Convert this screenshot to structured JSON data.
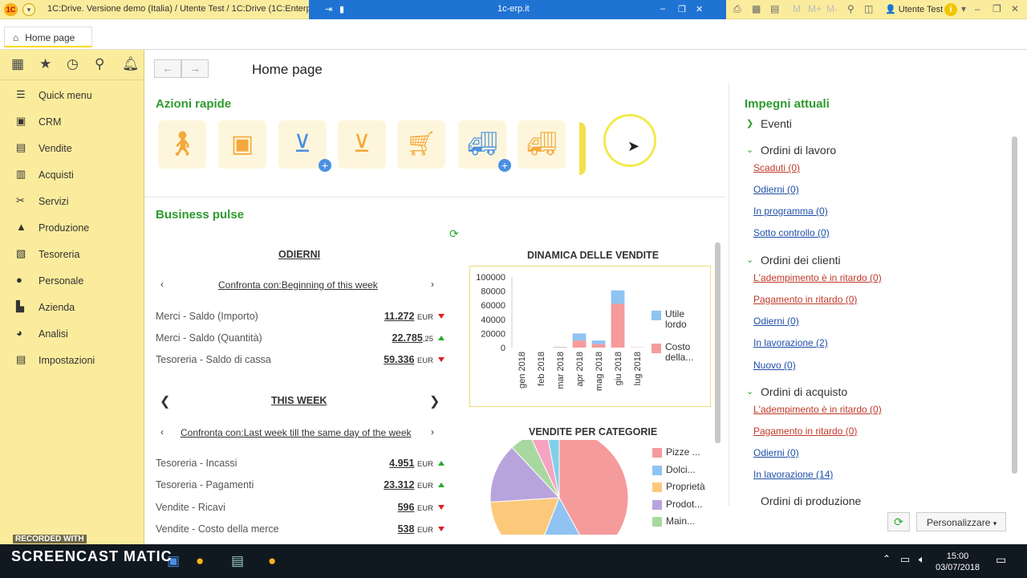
{
  "window": {
    "app_title": "1C:Drive. Versione demo (Italia) / Utente Test / 1C:Drive  (1C:Enterprise)",
    "remote_host": "1c-erp.it",
    "user": "Utente Test"
  },
  "tabs": [
    {
      "label": "Home page"
    }
  ],
  "sidebar": {
    "items": [
      {
        "label": "Quick menu",
        "icon": "list-icon"
      },
      {
        "label": "CRM",
        "icon": "crm-icon"
      },
      {
        "label": "Vendite",
        "icon": "sales-icon"
      },
      {
        "label": "Acquisti",
        "icon": "purchases-icon"
      },
      {
        "label": "Servizi",
        "icon": "services-icon"
      },
      {
        "label": "Produzione",
        "icon": "production-icon"
      },
      {
        "label": "Tesoreria",
        "icon": "treasury-icon"
      },
      {
        "label": "Personale",
        "icon": "personnel-icon"
      },
      {
        "label": "Azienda",
        "icon": "company-icon"
      },
      {
        "label": "Analisi",
        "icon": "analytics-icon"
      },
      {
        "label": "Impostazioni",
        "icon": "settings-icon"
      }
    ]
  },
  "main": {
    "title": "Home page",
    "quick_actions_title": "Azioni rapide",
    "business_pulse_title": "Business pulse",
    "today": {
      "title": "ODIERNI",
      "compare": "Confronta con:Beginning of this week",
      "metrics": [
        {
          "label": "Merci - Saldo (Importo)",
          "value": "11.272",
          "unit": "EUR",
          "trend": "down"
        },
        {
          "label": "Merci - Saldo (Quantità)",
          "value": "22.785",
          "decimals": ",25",
          "unit": "",
          "trend": "up"
        },
        {
          "label": "Tesoreria - Saldo di cassa",
          "value": "59.336",
          "unit": "EUR",
          "trend": "down"
        }
      ]
    },
    "week": {
      "title": "THIS WEEK",
      "compare": "Confronta con:Last week till the same day of the week",
      "metrics": [
        {
          "label": "Tesoreria - Incassi",
          "value": "4.951",
          "unit": "EUR",
          "trend": "up"
        },
        {
          "label": "Tesoreria - Pagamenti",
          "value": "23.312",
          "unit": "EUR",
          "trend": "up"
        },
        {
          "label": "Vendite - Ricavi",
          "value": "596",
          "unit": "EUR",
          "trend": "down"
        },
        {
          "label": "Vendite - Costo della merce",
          "value": "538",
          "unit": "EUR",
          "trend": "down"
        }
      ]
    }
  },
  "chart_data": [
    {
      "type": "bar",
      "title": "DINAMICA DELLE VENDITE",
      "categories": [
        "gen 2018",
        "feb 2018",
        "mar 2018",
        "apr 2018",
        "mag 2018",
        "giu 2018",
        "lug 2018"
      ],
      "series": [
        {
          "name": "Costo della...",
          "color": "#f59b9b",
          "values": [
            0,
            0,
            500,
            10000,
            5000,
            62000,
            300
          ]
        },
        {
          "name": "Utile lordo",
          "color": "#8fc3f2",
          "values": [
            0,
            0,
            500,
            10000,
            5000,
            19000,
            200
          ]
        }
      ],
      "stacked": true,
      "ylim": [
        0,
        100000
      ],
      "yticks": [
        "100000",
        "80000",
        "60000",
        "40000",
        "20000",
        "0"
      ],
      "legend": "right"
    },
    {
      "type": "pie",
      "title": "VENDITE PER CATEGORIE",
      "slices": [
        {
          "name": "Pizze ...",
          "color": "#f59b9b",
          "value": 42
        },
        {
          "name": "Dolci...",
          "color": "#8fc3f2",
          "value": 14
        },
        {
          "name": "Proprietà",
          "color": "#fcc97a",
          "value": 18
        },
        {
          "name": "Prodot...",
          "color": "#b9a3dc",
          "value": 14
        },
        {
          "name": "Main...",
          "color": "#a8d8a0",
          "value": 5
        },
        {
          "name": "",
          "color": "#f5a3c0",
          "value": 4
        },
        {
          "name": "",
          "color": "#7fd0e8",
          "value": 3
        }
      ],
      "legend": "right"
    }
  ],
  "right": {
    "title": "Impegni attuali",
    "groups": [
      {
        "label": "Eventi",
        "expanded": false,
        "links": []
      },
      {
        "label": "Ordini di lavoro",
        "expanded": true,
        "links": [
          {
            "label": "Scaduti (0)",
            "color": "red"
          },
          {
            "label": "Odierni (0)",
            "color": "blue"
          },
          {
            "label": "In programma (0)",
            "color": "blue"
          },
          {
            "label": "Sotto controllo (0)",
            "color": "blue"
          }
        ]
      },
      {
        "label": "Ordini dei clienti",
        "expanded": true,
        "links": [
          {
            "label": "L'adempimento è in ritardo (0)",
            "color": "red"
          },
          {
            "label": "Pagamento in ritardo (0)",
            "color": "red"
          },
          {
            "label": "Odierni (0)",
            "color": "blue"
          },
          {
            "label": "In lavorazione (2)",
            "color": "blue"
          },
          {
            "label": "Nuovo (0)",
            "color": "blue"
          }
        ]
      },
      {
        "label": "Ordini di acquisto",
        "expanded": true,
        "links": [
          {
            "label": "L'adempimento è in ritardo (0)",
            "color": "red"
          },
          {
            "label": "Pagamento in ritardo (0)",
            "color": "red"
          },
          {
            "label": "Odierni (0)",
            "color": "blue"
          },
          {
            "label": "In lavorazione (14)",
            "color": "blue"
          }
        ]
      },
      {
        "label": "Ordini di produzione",
        "expanded": true,
        "links": []
      }
    ],
    "customize_label": "Personalizzare"
  },
  "taskbar": {
    "time": "15:00",
    "date": "03/07/2018",
    "watermark_top": "RECORDED WITH",
    "watermark": "SCREENCAST  MATIC"
  }
}
